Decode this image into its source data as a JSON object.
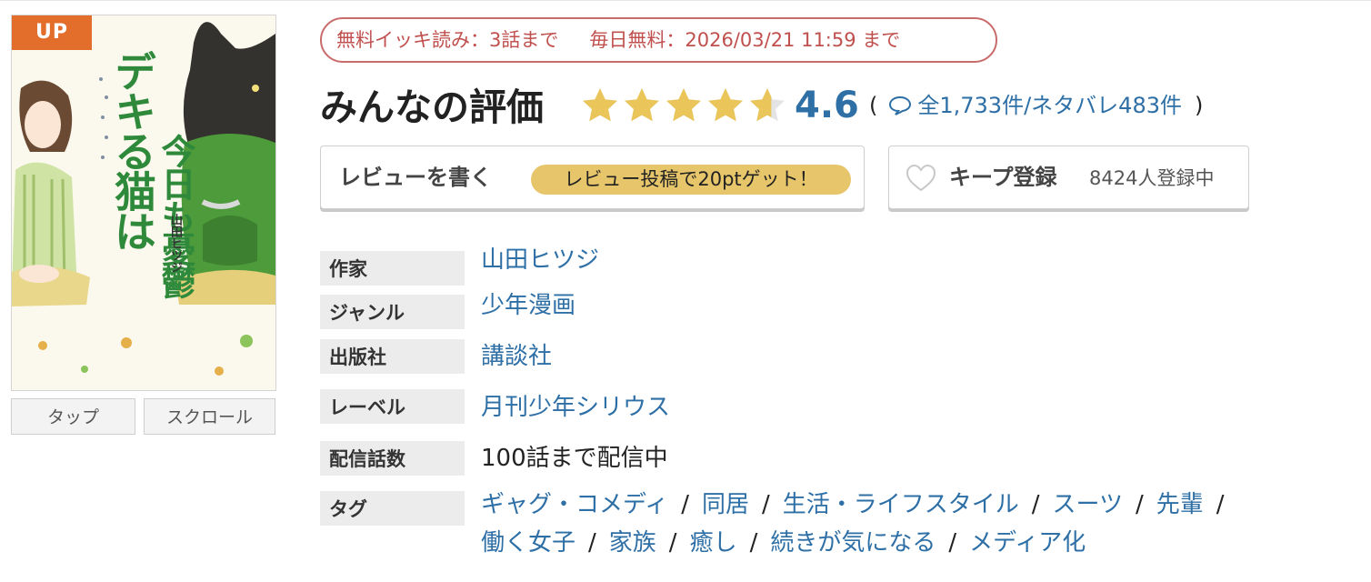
{
  "cover": {
    "badge": "UP",
    "title_line1": "デキる猫は",
    "title_line2": "今日も憂鬱",
    "author_small": "山田ヒツジ",
    "buttons": {
      "tap": "タップ",
      "scroll": "スクロール"
    }
  },
  "free_info": {
    "ikki": "無料イッキ読み：3話まで",
    "daily": "毎日無料：2026/03/21 11:59 まで"
  },
  "rating": {
    "label": "みんなの評価",
    "stars": 4.6,
    "value": "4.6",
    "open_paren": "(",
    "total": "全1,733件",
    "spoiler": "/ネタバレ483件",
    "close_paren": ")",
    "star_color": "#e9c55a"
  },
  "review_button": {
    "label": "レビューを書く",
    "promo": "レビュー投稿で20ptゲット！"
  },
  "keep_button": {
    "label": "キープ登録",
    "count": "8424人登録中"
  },
  "info": {
    "author": {
      "label": "作家",
      "value": "山田ヒツジ"
    },
    "genre": {
      "label": "ジャンル",
      "value": "少年漫画"
    },
    "publisher": {
      "label": "出版社",
      "value": "講談社"
    },
    "label_row": {
      "label": "レーベル",
      "value": "月刊少年シリウス"
    },
    "episodes": {
      "label": "配信話数",
      "value": "100話まで配信中"
    },
    "tags": {
      "label": "タグ",
      "items": [
        "ギャグ・コメディ",
        "同居",
        "生活・ライフスタイル",
        "スーツ",
        "先輩",
        "働く女子",
        "家族",
        "癒し",
        "続きが気になる",
        "メディア化"
      ],
      "separator": "/"
    }
  },
  "colors": {
    "link": "#2e6fa6",
    "pill_border": "#c96b6b",
    "badge": "#e36d2b",
    "promo": "#e7c66b"
  }
}
